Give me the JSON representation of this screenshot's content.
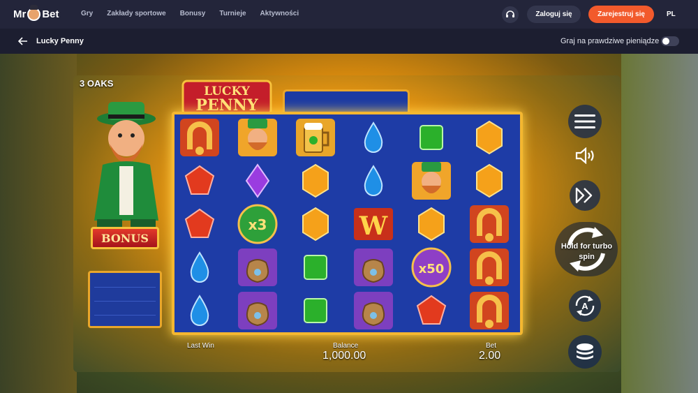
{
  "header": {
    "logo_left": "Mr",
    "logo_right": "Bet",
    "nav": [
      "Gry",
      "Zakłady sportowe",
      "Bonusy",
      "Turnieje",
      "Aktywności"
    ],
    "login_label": "Zaloguj się",
    "register_label": "Zarejestruj się",
    "language": "PL",
    "icons": {
      "support": "headset-icon"
    }
  },
  "subheader": {
    "back_icon": "arrow-left-icon",
    "title": "Lucky Penny",
    "real_money_label": "Graj na prawdziwe pieniądze",
    "real_money_on": false
  },
  "game": {
    "provider": "3 OAKS",
    "logo_line1": "LUCKY",
    "logo_line2": "PENNY",
    "bonus_label": "BONUS",
    "reels": [
      [
        "horseshoe",
        "gem-red",
        "gem-red",
        "gem-blue",
        "gem-blue"
      ],
      [
        "leprechaun",
        "gem-purple",
        "x3",
        "bag",
        "bag"
      ],
      [
        "beer",
        "gem-orange",
        "gem-orange",
        "gem-green",
        "gem-green"
      ],
      [
        "gem-blue",
        "gem-blue",
        "wild",
        "bag",
        "bag"
      ],
      [
        "gem-green",
        "leprechaun",
        "gem-orange",
        "x50",
        "gem-red"
      ],
      [
        "gem-orange",
        "gem-orange",
        "horseshoe",
        "horseshoe",
        "horseshoe"
      ]
    ],
    "x3_label": "x3",
    "x50_label": "x50",
    "wild_label": "W",
    "last_win_label": "Last Win",
    "last_win_value": "",
    "balance_label": "Balance",
    "balance_value": "1,000.00",
    "bet_label": "Bet",
    "bet_value": "2.00",
    "turbo_hint": "Hold for turbo spin",
    "controls": [
      "menu-icon",
      "sound-icon",
      "fast-forward-icon",
      "spin-icon",
      "autoplay-icon",
      "coins-icon"
    ],
    "colors": {
      "accent": "#f25a2c",
      "reel_bg": "#1e3ca6",
      "frame": "#f4b730"
    }
  }
}
